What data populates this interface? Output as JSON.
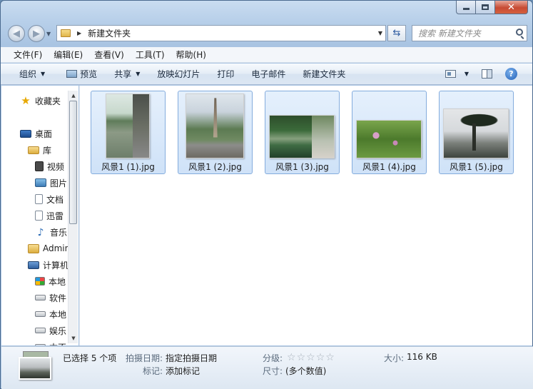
{
  "window": {
    "caption_buttons": [
      "minimize",
      "maximize",
      "close"
    ],
    "close_glyph": "✕"
  },
  "address_bar": {
    "breadcrumb": [
      "新建文件夹"
    ],
    "search_placeholder": "搜索 新建文件夹"
  },
  "menu": [
    "文件(F)",
    "编辑(E)",
    "查看(V)",
    "工具(T)",
    "帮助(H)"
  ],
  "toolbar": {
    "organize": "组织",
    "preview": "预览",
    "share": "共享",
    "slideshow": "放映幻灯片",
    "print": "打印",
    "email": "电子邮件",
    "new_folder": "新建文件夹"
  },
  "nav_pane": {
    "favorites": "收藏夹",
    "desktop": "桌面",
    "libraries": "库",
    "lib_items": [
      "视频",
      "图片",
      "文档",
      "迅雷",
      "音乐"
    ],
    "admin": "Admin",
    "computer": "计算机",
    "drives": [
      "本地",
      "软件",
      "本地",
      "娱乐",
      "本不"
    ]
  },
  "files": [
    {
      "name": "风景1 (1).jpg",
      "selected": true
    },
    {
      "name": "风景1 (2).jpg",
      "selected": true
    },
    {
      "name": "风景1 (3).jpg",
      "selected": true
    },
    {
      "name": "风景1 (4).jpg",
      "selected": true
    },
    {
      "name": "风景1 (5).jpg",
      "selected": true
    }
  ],
  "details": {
    "selection": "已选择 5 个项",
    "date_taken_label": "拍摄日期:",
    "date_taken_value": "指定拍摄日期",
    "tags_label": "标记:",
    "tags_value": "添加标记",
    "rating_label": "分级:",
    "rating_stars": 0,
    "rating_max": 5,
    "size_label": "大小:",
    "size_value": "116 KB",
    "dimensions_label": "尺寸:",
    "dimensions_value": "(多个数值)"
  },
  "colors": {
    "selection_border": "#84acdd",
    "selection_fill": "#dbe9fa",
    "close_button": "#c74b34"
  }
}
